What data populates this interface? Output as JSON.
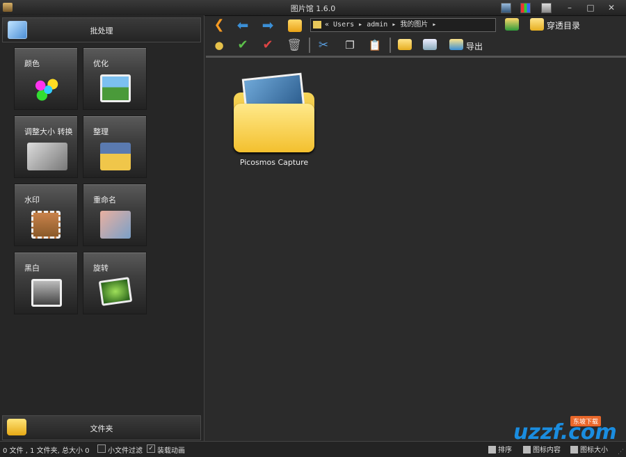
{
  "window": {
    "title": "图片馆 1.6.0"
  },
  "left_panel": {
    "header_label": "批处理",
    "tiles": [
      {
        "label": "颜色",
        "icon": "color-palette-icon"
      },
      {
        "label": "优化",
        "icon": "optimize-brush-icon"
      },
      {
        "label": "调整大小 转换",
        "icon": "resize-convert-icon"
      },
      {
        "label": "整理",
        "icon": "organize-photos-icon"
      },
      {
        "label": "水印",
        "icon": "watermark-stamp-icon"
      },
      {
        "label": "重命名",
        "icon": "rename-icon"
      },
      {
        "label": "黑白",
        "icon": "black-white-icon"
      },
      {
        "label": "旋转",
        "icon": "rotate-icon"
      }
    ],
    "footer_label": "文件夹"
  },
  "toolbar": {
    "address": "« Users ▸ admin ▸ 我的图片 ▸",
    "through_dir_label": "穿透目录",
    "export_label": "导出"
  },
  "content": {
    "items": [
      {
        "label": "Picosmos Capture",
        "type": "folder"
      }
    ]
  },
  "status": {
    "summary": "0 文件 , 1 文件夹, 总大小 0",
    "small_file_filter": "小文件过滤",
    "load_animation": "装载动画",
    "sort_label": "排序",
    "icon_content_label": "图标内容",
    "icon_size_label": "图标大小"
  },
  "watermark": {
    "text": "uzzf.com",
    "sub": "东坡下载"
  },
  "colors": {
    "accent_orange": "#f59a23",
    "arrow_blue": "#3b8fd6",
    "folder_yellow": "#f3c02e"
  }
}
